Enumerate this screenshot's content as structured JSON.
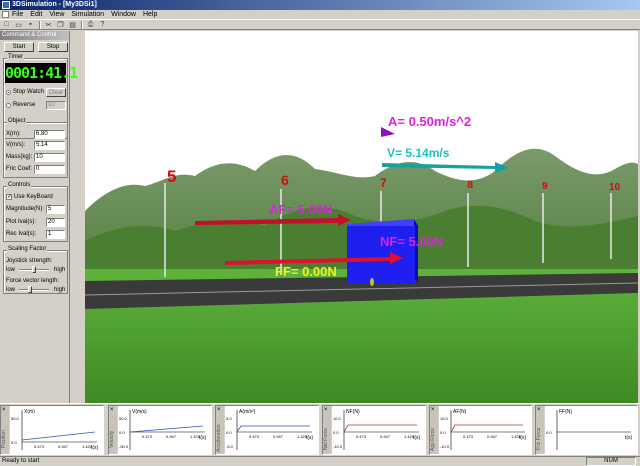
{
  "window": {
    "title": "3DSimulation - [My3DSi1]"
  },
  "menu": [
    "File",
    "Edit",
    "View",
    "Simulation",
    "Window",
    "Help"
  ],
  "toolbar": [
    {
      "icon": "new-file-icon",
      "glyph": "□"
    },
    {
      "icon": "open-folder-icon",
      "glyph": "▭"
    },
    {
      "icon": "save-icon",
      "glyph": "▪"
    },
    {
      "icon": "cut-icon",
      "glyph": "✂"
    },
    {
      "icon": "copy-icon",
      "glyph": "❐"
    },
    {
      "icon": "paste-icon",
      "glyph": "▤"
    },
    {
      "icon": "print-icon",
      "glyph": "⎙"
    },
    {
      "icon": "help-icon",
      "glyph": "?"
    }
  ],
  "panel": {
    "title": "Command & Control",
    "start_label": "Start",
    "stop_label": "Stop",
    "timer": {
      "title": "Timer",
      "display": "0001:41.1",
      "stop_watch_label": "Stop Watch",
      "clear_label": "Clear",
      "reverse_label": "Reverse",
      "reverse_value": "10"
    },
    "object": {
      "title": "Object",
      "fields": [
        {
          "label": "X(m):",
          "value": "6.80"
        },
        {
          "label": "V(m/s):",
          "value": "5.14"
        },
        {
          "label": "Mass(kg):",
          "value": "10"
        },
        {
          "label": "Fric Coef:",
          "value": "0"
        }
      ]
    },
    "controls": {
      "title": "Controls",
      "use_keyboard_label": "Use KeyBoard",
      "fields": [
        {
          "label": "Magnitude(N):",
          "value": "5"
        },
        {
          "label": "Plot Ival(s):",
          "value": "20"
        },
        {
          "label": "Rec Ival(s):",
          "value": "1"
        }
      ]
    },
    "scaling": {
      "title": "Scaling Factor",
      "joystick_label": "Joystick strength:",
      "force_label": "Force vector length:",
      "low": "low",
      "high": "high",
      "joystick_level": 0.5,
      "force_level": 0.35
    }
  },
  "scene": {
    "markers": [
      "5",
      "6",
      "7",
      "8",
      "9",
      "10"
    ],
    "acceleration_label": "A= 0.50m/s^2",
    "velocity_label": "V= 5.14m/s",
    "applied_force_label": "AF= 5.00N",
    "normal_force_label": "NF= 5.00N",
    "friction_force_label": "FF= 0.00N",
    "colors": {
      "sky": "#ffffff",
      "grass": "#4f9d2f",
      "mountain": "#5e8c4a",
      "road": "#3a3a3a",
      "box": "#1f1ff0",
      "applied_arrow": "#c0102a",
      "normal_arrow": "#e0102a",
      "velocity_arrow": "#18a0a0",
      "accel_arrow": "#9010c0",
      "magenta_text": "#e020e0",
      "cyan_text": "#20c0c0",
      "yellow_text": "#f0f020",
      "marker_text": "#cc1010"
    }
  },
  "graphs": [
    {
      "ylabel": "X(m)",
      "y_ticks": [
        "50.0",
        "0.0"
      ],
      "x_ticks": [
        "0.473",
        "0.947",
        "1.420"
      ],
      "xlabel": "t(s)",
      "tab": "Position"
    },
    {
      "ylabel": "V(m/s)",
      "y_ticks": [
        "50.0",
        "0.0",
        "-50.0"
      ],
      "x_ticks": [
        "0.473",
        "0.947",
        "1.420"
      ],
      "xlabel": "t(s)",
      "tab": "Velocity"
    },
    {
      "ylabel": "A(m/s²)",
      "y_ticks": [
        "5.0",
        "0.0",
        "-5.0"
      ],
      "x_ticks": [
        "0.473",
        "0.947",
        "1.420"
      ],
      "xlabel": "t(s)",
      "tab": "Acceleration"
    },
    {
      "ylabel": "NF(N)",
      "y_ticks": [
        "10.0",
        "0.0",
        "-10.0"
      ],
      "x_ticks": [
        "0.473",
        "0.947",
        "1.420"
      ],
      "xlabel": "t(s)",
      "tab": "Net Force"
    },
    {
      "ylabel": "AF(N)",
      "y_ticks": [
        "10.0",
        "0.0",
        "-10.0"
      ],
      "x_ticks": [
        "0.473",
        "0.947",
        "1.420"
      ],
      "xlabel": "t(s)",
      "tab": "App Force"
    },
    {
      "ylabel": "FF(N)",
      "y_ticks": [
        "0.0"
      ],
      "x_ticks": [],
      "xlabel": "t(s)",
      "tab": "Fric Force"
    }
  ],
  "status": {
    "text": "Ready to start",
    "num": "NUM"
  }
}
